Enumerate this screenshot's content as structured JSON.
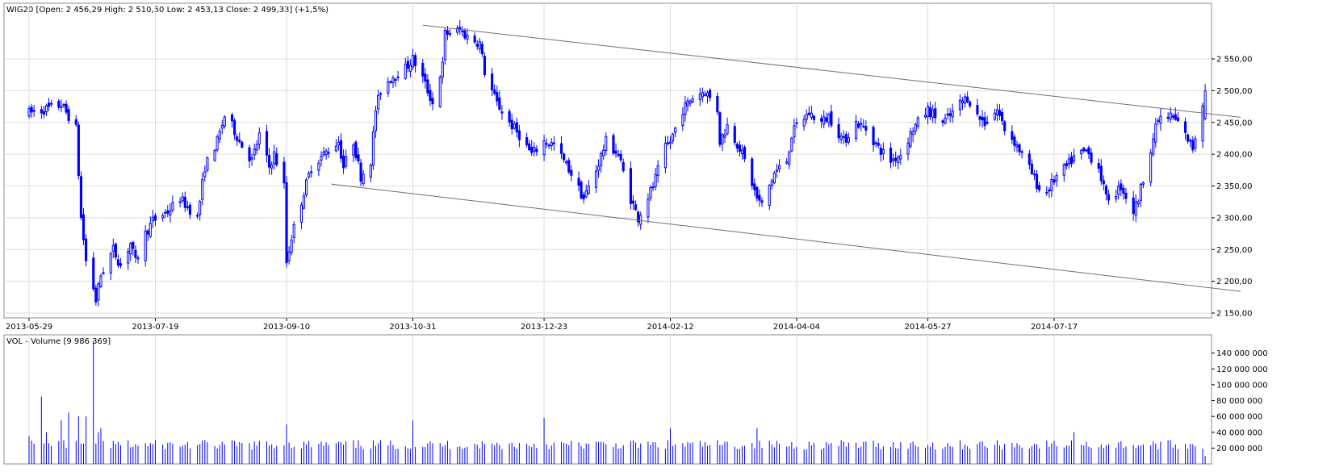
{
  "chart_data": [
    {
      "type": "candlestick",
      "title": "WIG20 [Open: 2 456,29  High: 2 510,50  Low: 2 453,13  Close: 2 499,33] (+1,5%)",
      "ylim": [
        2140,
        2620
      ],
      "y_ticks": [
        {
          "value": 2150,
          "label": "2 150,00"
        },
        {
          "value": 2200,
          "label": "2 200,00"
        },
        {
          "value": 2250,
          "label": "2 250,00"
        },
        {
          "value": 2300,
          "label": "2 300,00"
        },
        {
          "value": 2350,
          "label": "2 350,00"
        },
        {
          "value": 2400,
          "label": "2 400,00"
        },
        {
          "value": 2450,
          "label": "2 450,00"
        },
        {
          "value": 2500,
          "label": "2 500,00"
        },
        {
          "value": 2550,
          "label": "2 550,00"
        }
      ],
      "x_ticks": [
        "2013-05-29",
        "2013-07-19",
        "2013-09-10",
        "2013-10-31",
        "2013-12-23",
        "2014-02-12",
        "2014-04-04",
        "2014-05-27",
        "2014-07-17"
      ],
      "grid": true,
      "color": "#0000ff",
      "trendlines": [
        {
          "from": {
            "date": "2013-11-04",
            "value": 2603
          },
          "to": {
            "date": "2014-09-16",
            "value": 2453
          }
        },
        {
          "from": {
            "date": "2013-09-28",
            "value": 2353
          },
          "to": {
            "date": "2014-09-16",
            "value": 2179
          }
        }
      ],
      "anchors": [
        [
          "2013-05-29",
          2465
        ],
        [
          "2013-06-04",
          2470
        ],
        [
          "2013-06-11",
          2478
        ],
        [
          "2013-06-14",
          2460
        ],
        [
          "2013-06-17",
          2440
        ],
        [
          "2013-06-19",
          2300
        ],
        [
          "2013-06-21",
          2232
        ],
        [
          "2013-06-24",
          2190
        ],
        [
          "2013-06-25",
          2170
        ],
        [
          "2013-06-27",
          2210
        ],
        [
          "2013-07-02",
          2250
        ],
        [
          "2013-07-05",
          2225
        ],
        [
          "2013-07-09",
          2260
        ],
        [
          "2013-07-11",
          2230
        ],
        [
          "2013-07-15",
          2275
        ],
        [
          "2013-07-18",
          2295
        ],
        [
          "2013-07-24",
          2310
        ],
        [
          "2013-07-29",
          2330
        ],
        [
          "2013-08-05",
          2300
        ],
        [
          "2013-08-08",
          2380
        ],
        [
          "2013-08-13",
          2420
        ],
        [
          "2013-08-16",
          2460
        ],
        [
          "2013-08-19",
          2445
        ],
        [
          "2013-08-22",
          2420
        ],
        [
          "2013-08-27",
          2390
        ],
        [
          "2013-08-30",
          2430
        ],
        [
          "2013-09-03",
          2380
        ],
        [
          "2013-09-05",
          2400
        ],
        [
          "2013-09-09",
          2350
        ],
        [
          "2013-09-10",
          2230
        ],
        [
          "2013-09-12",
          2270
        ],
        [
          "2013-09-17",
          2340
        ],
        [
          "2013-09-20",
          2380
        ],
        [
          "2013-09-25",
          2400
        ],
        [
          "2013-10-01",
          2420
        ],
        [
          "2013-10-03",
          2380
        ],
        [
          "2013-10-07",
          2420
        ],
        [
          "2013-10-10",
          2365
        ],
        [
          "2013-10-14",
          2390
        ],
        [
          "2013-10-16",
          2470
        ],
        [
          "2013-10-18",
          2500
        ],
        [
          "2013-10-22",
          2520
        ],
        [
          "2013-10-28",
          2535
        ],
        [
          "2013-10-31",
          2550
        ],
        [
          "2013-11-04",
          2520
        ],
        [
          "2013-11-07",
          2490
        ],
        [
          "2013-11-08",
          2480
        ],
        [
          "2013-11-12",
          2540
        ],
        [
          "2013-11-13",
          2590
        ],
        [
          "2013-11-19",
          2595
        ],
        [
          "2013-11-22",
          2585
        ],
        [
          "2013-11-27",
          2575
        ],
        [
          "2013-11-29",
          2530
        ],
        [
          "2013-12-04",
          2480
        ],
        [
          "2013-12-09",
          2450
        ],
        [
          "2013-12-13",
          2430
        ],
        [
          "2013-12-18",
          2400
        ],
        [
          "2013-12-23",
          2420
        ],
        [
          "2013-12-27",
          2415
        ],
        [
          "2014-01-03",
          2370
        ],
        [
          "2014-01-08",
          2330
        ],
        [
          "2014-01-13",
          2375
        ],
        [
          "2014-01-17",
          2420
        ],
        [
          "2014-01-22",
          2400
        ],
        [
          "2014-01-27",
          2330
        ],
        [
          "2014-01-30",
          2300
        ],
        [
          "2014-02-05",
          2350
        ],
        [
          "2014-02-10",
          2410
        ],
        [
          "2014-02-12",
          2420
        ],
        [
          "2014-02-17",
          2470
        ],
        [
          "2014-02-21",
          2490
        ],
        [
          "2014-02-26",
          2500
        ],
        [
          "2014-03-03",
          2470
        ],
        [
          "2014-03-04",
          2420
        ],
        [
          "2014-03-07",
          2445
        ],
        [
          "2014-03-12",
          2410
        ],
        [
          "2014-03-14",
          2390
        ],
        [
          "2014-03-19",
          2330
        ],
        [
          "2014-03-21",
          2320
        ],
        [
          "2014-03-26",
          2370
        ],
        [
          "2014-03-31",
          2390
        ],
        [
          "2014-04-02",
          2430
        ],
        [
          "2014-04-04",
          2445
        ],
        [
          "2014-04-09",
          2465
        ],
        [
          "2014-04-14",
          2450
        ],
        [
          "2014-04-17",
          2460
        ],
        [
          "2014-04-23",
          2420
        ],
        [
          "2014-04-28",
          2450
        ],
        [
          "2014-05-02",
          2440
        ],
        [
          "2014-05-07",
          2410
        ],
        [
          "2014-05-12",
          2390
        ],
        [
          "2014-05-16",
          2400
        ],
        [
          "2014-05-21",
          2440
        ],
        [
          "2014-05-27",
          2470
        ],
        [
          "2014-06-02",
          2450
        ],
        [
          "2014-06-05",
          2460
        ],
        [
          "2014-06-09",
          2480
        ],
        [
          "2014-06-12",
          2490
        ],
        [
          "2014-06-16",
          2460
        ],
        [
          "2014-06-19",
          2450
        ],
        [
          "2014-06-24",
          2470
        ],
        [
          "2014-06-27",
          2440
        ],
        [
          "2014-07-01",
          2420
        ],
        [
          "2014-07-04",
          2400
        ],
        [
          "2014-07-08",
          2370
        ],
        [
          "2014-07-11",
          2345
        ],
        [
          "2014-07-14",
          2340
        ],
        [
          "2014-07-17",
          2360
        ],
        [
          "2014-07-22",
          2380
        ],
        [
          "2014-07-25",
          2395
        ],
        [
          "2014-07-30",
          2405
        ],
        [
          "2014-08-04",
          2380
        ],
        [
          "2014-08-07",
          2330
        ],
        [
          "2014-08-11",
          2340
        ],
        [
          "2014-08-13",
          2350
        ],
        [
          "2014-08-18",
          2310
        ],
        [
          "2014-08-20",
          2330
        ],
        [
          "2014-08-25",
          2410
        ],
        [
          "2014-08-28",
          2455
        ],
        [
          "2014-09-02",
          2460
        ],
        [
          "2014-09-05",
          2450
        ],
        [
          "2014-09-08",
          2430
        ],
        [
          "2014-09-11",
          2410
        ],
        [
          "2014-09-16",
          2499
        ]
      ]
    },
    {
      "type": "bar",
      "title": "VOL - Volume [9 986 369]",
      "ylim": [
        0,
        160000000
      ],
      "y_ticks": [
        {
          "value": 20000000,
          "label": "20 000 000"
        },
        {
          "value": 40000000,
          "label": "40 000 000"
        },
        {
          "value": 60000000,
          "label": "60 000 000"
        },
        {
          "value": 80000000,
          "label": "80 000 000"
        },
        {
          "value": 100000000,
          "label": "100 000 000"
        },
        {
          "value": 120000000,
          "label": "120 000 000"
        },
        {
          "value": 140000000,
          "label": "140 000 000"
        }
      ],
      "color": "#0000ff",
      "spikes": [
        [
          "2013-05-29",
          35000000
        ],
        [
          "2013-06-03",
          85000000
        ],
        [
          "2013-06-05",
          40000000
        ],
        [
          "2013-06-11",
          55000000
        ],
        [
          "2013-06-14",
          65000000
        ],
        [
          "2013-06-18",
          60000000
        ],
        [
          "2013-06-21",
          60000000
        ],
        [
          "2013-06-24",
          155000000
        ],
        [
          "2013-06-26",
          40000000
        ],
        [
          "2013-06-27",
          45000000
        ],
        [
          "2013-09-10",
          50000000
        ],
        [
          "2013-10-31",
          55000000
        ],
        [
          "2013-12-23",
          58000000
        ],
        [
          "2014-02-12",
          45000000
        ],
        [
          "2014-03-19",
          45000000
        ],
        [
          "2014-07-25",
          40000000
        ]
      ],
      "base_volume_millions": 23
    }
  ]
}
